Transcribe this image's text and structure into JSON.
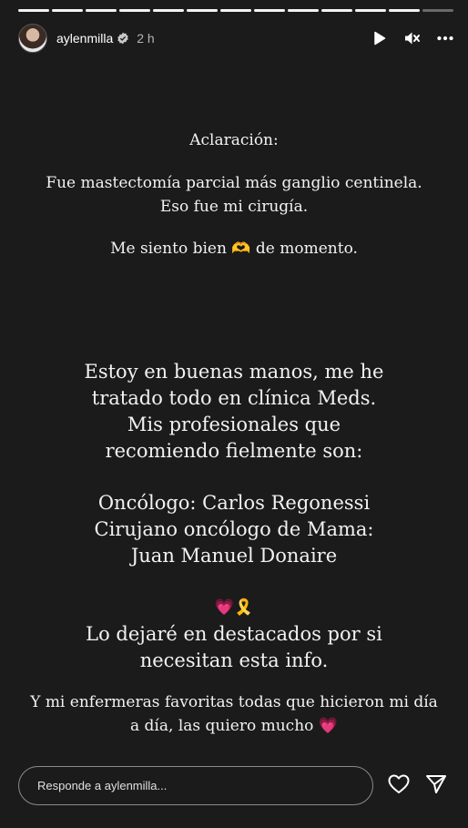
{
  "story": {
    "segments_total": 13,
    "segments_done": 12
  },
  "header": {
    "username": "aylenmilla",
    "time": "2 h",
    "verified": true
  },
  "text": {
    "line1": "Aclaración:",
    "line2": "Fue mastectomía parcial más ganglio centinela.",
    "line3": "Eso fue mi cirugía.",
    "line4a": "Me siento bien",
    "line4_emoji": "🫶",
    "line4b": "de momento.",
    "big1": "Estoy en buenas manos, me he",
    "big2": "tratado todo en clínica Meds.",
    "big3": "Mis profesionales que",
    "big4": "recomiendo fielmente son:",
    "big5": "Oncólogo: Carlos Regonessi",
    "big6": "Cirujano oncólogo de Mama:",
    "big7": "Juan Manuel Donaire",
    "emoji_row": "💗🎗️",
    "big8": "Lo dejaré en destacados por si",
    "big9": "necesitan esta info.",
    "small1": "Y mi enfermeras favoritas todas que hicieron mi día",
    "small2a": "a día, las quiero mucho",
    "small2_emoji": "💗"
  },
  "footer": {
    "reply_placeholder": "Responde a aylenmilla..."
  }
}
